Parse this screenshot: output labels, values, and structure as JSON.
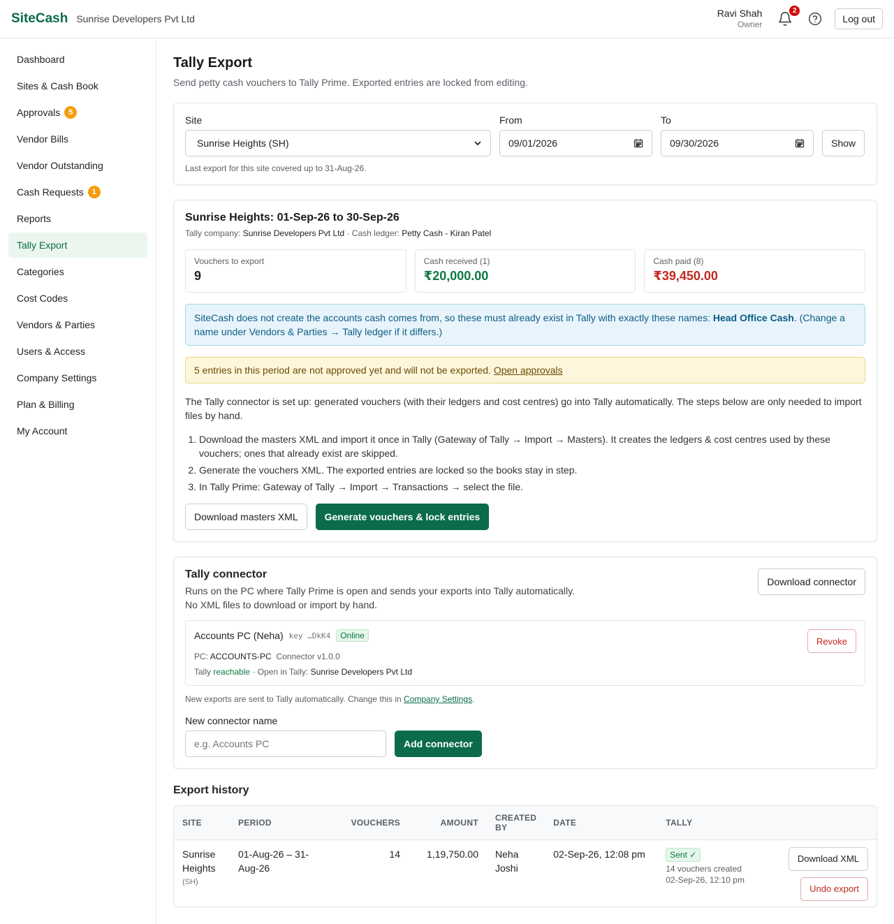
{
  "header": {
    "brand": "SiteCash",
    "company": "Sunrise Developers Pvt Ltd",
    "user_name": "Ravi Shah",
    "user_role": "Owner",
    "notifications_count": "2",
    "logout_label": "Log out"
  },
  "sidebar": {
    "items": [
      {
        "label": "Dashboard"
      },
      {
        "label": "Sites & Cash Book"
      },
      {
        "label": "Approvals",
        "badge": "5"
      },
      {
        "label": "Vendor Bills"
      },
      {
        "label": "Vendor Outstanding"
      },
      {
        "label": "Cash Requests",
        "badge": "1"
      },
      {
        "label": "Reports"
      },
      {
        "label": "Tally Export",
        "active": true
      },
      {
        "label": "Categories"
      },
      {
        "label": "Cost Codes"
      },
      {
        "label": "Vendors & Parties"
      },
      {
        "label": "Users & Access"
      },
      {
        "label": "Company Settings"
      },
      {
        "label": "Plan & Billing"
      },
      {
        "label": "My Account"
      }
    ]
  },
  "page": {
    "title": "Tally Export",
    "subtitle": "Send petty cash vouchers to Tally Prime. Exported entries are locked from editing."
  },
  "filters": {
    "site_label": "Site",
    "site_value": "Sunrise Heights (SH)",
    "from_label": "From",
    "from_value": "09/01/2026",
    "to_label": "To",
    "to_value": "09/30/2026",
    "show_label": "Show",
    "hint": "Last export for this site covered up to 31-Aug-26."
  },
  "period": {
    "title": "Sunrise Heights: 01-Sep-26 to 30-Sep-26",
    "company_label": "Tally company:",
    "company_value": "Sunrise Developers Pvt Ltd",
    "ledger_label": "· Cash ledger:",
    "ledger_value": "Petty Cash - Kiran Patel",
    "stats": [
      {
        "label": "Vouchers to export",
        "value": "9"
      },
      {
        "label": "Cash received (1)",
        "value": "₹20,000.00"
      },
      {
        "label": "Cash paid (8)",
        "value": "₹39,450.00"
      }
    ],
    "info_pre": "SiteCash does not create the accounts cash comes from, so these must already exist in Tally with exactly these names: ",
    "info_bold": "Head Office Cash",
    "info_post": ". (Change a name under Vendors & Parties → Tally ledger if it differs.)",
    "warn_text": "5 entries in this period are not approved yet and will not be exported. ",
    "warn_link": "Open approvals",
    "para": "The Tally connector is set up: generated vouchers (with their ledgers and cost centres) go into Tally automatically. The steps below are only needed to import files by hand.",
    "steps": [
      "Download the masters XML and import it once in Tally (Gateway of Tally → Import → Masters). It creates the ledgers & cost centres used by these vouchers; ones that already exist are skipped.",
      "Generate the vouchers XML. The exported entries are locked so the books stay in step.",
      "In Tally Prime: Gateway of Tally → Import → Transactions → select the file."
    ],
    "download_masters_label": "Download masters XML",
    "generate_label": "Generate vouchers & lock entries"
  },
  "connector": {
    "title": "Tally connector",
    "desc_1": "Runs on the PC where Tally Prime is open and sends your exports into Tally automatically.",
    "desc_2": "No XML files to download or import by hand.",
    "download_label": "Download connector",
    "device_name": "Accounts PC (Neha)",
    "key_text": "key  …DkK4",
    "status": "Online",
    "pc_label": "PC:",
    "pc_value": "ACCOUNTS-PC",
    "version": "Connector v1.0.0",
    "tally_label": "Tally",
    "tally_status": "reachable",
    "open_label": "· Open in Tally:",
    "open_value": "Sunrise Developers Pvt Ltd",
    "revoke_label": "Revoke",
    "auto_note": "New exports are sent to Tally automatically. Change this in ",
    "auto_link": "Company Settings",
    "auto_end": ".",
    "new_name_label": "New connector name",
    "new_name_placeholder": "e.g. Accounts PC",
    "add_label": "Add connector"
  },
  "history": {
    "title": "Export history",
    "columns": [
      "SITE",
      "PERIOD",
      "VOUCHERS",
      "AMOUNT",
      "CREATED BY",
      "DATE",
      "TALLY"
    ],
    "rows": [
      {
        "site": "Sunrise Heights",
        "site_code": "(SH)",
        "period": "01-Aug-26 – 31-Aug-26",
        "vouchers": "14",
        "amount": "1,19,750.00",
        "created_by": "Neha Joshi",
        "date": "02-Sep-26, 12:08 pm",
        "tally_status": "Sent ✓",
        "tally_detail": "14 vouchers created",
        "tally_time": "02-Sep-26, 12:10 pm",
        "download_label": "Download XML",
        "undo_label": "Undo export"
      }
    ]
  },
  "colors": {
    "brand": "#0b6b4a",
    "positive": "#0b7a3e",
    "negative": "#c2281f",
    "alert": "#d40c0c",
    "badge": "#f59e0b"
  }
}
